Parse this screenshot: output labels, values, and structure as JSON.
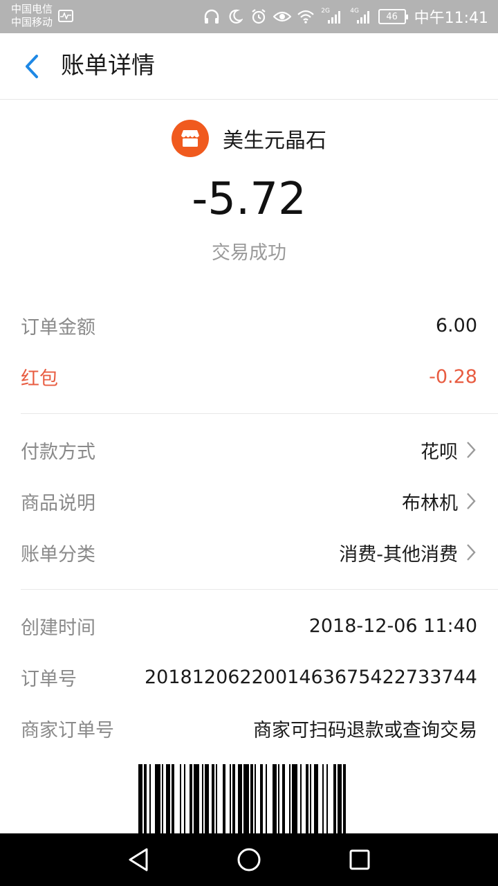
{
  "status_bar": {
    "carrier_1": "中国电信",
    "carrier_2": "中国移动",
    "sig1_label": "2G",
    "sig2_label": "4G",
    "battery": "46",
    "time": "中午11:41",
    "icons": [
      "pulse-icon",
      "headphones-icon",
      "moon-icon",
      "alarm-icon",
      "eye-icon",
      "wifi-icon",
      "signal-icon",
      "signal-icon",
      "battery-icon"
    ]
  },
  "header": {
    "title": "账单详情",
    "back_icon": "chevron-left-icon",
    "accent_color": "#1e88e5"
  },
  "merchant": {
    "name": "美生元晶石",
    "logo_icon": "shop-icon",
    "logo_color": "#f05a1e",
    "amount": "-5.72",
    "status": "交易成功"
  },
  "details": {
    "order_amount": {
      "label": "订单金额",
      "value": "6.00"
    },
    "red_packet": {
      "label": "红包",
      "value": "-0.28",
      "color": "#e85c41"
    },
    "payment_method": {
      "label": "付款方式",
      "value": "花呗"
    },
    "product_desc": {
      "label": "商品说明",
      "value": "布林机"
    },
    "bill_category": {
      "label": "账单分类",
      "value": "消费-其他消费"
    },
    "created_time": {
      "label": "创建时间",
      "value": "2018-12-06 11:40"
    },
    "order_no": {
      "label": "订单号",
      "value": "2018120622001463675422733744"
    },
    "merchant_order_no": {
      "label": "商家订单号",
      "value": "商家可扫码退款或查询交易"
    }
  },
  "nav": {
    "icons": [
      "back-triangle-icon",
      "home-circle-icon",
      "recents-square-icon"
    ]
  }
}
